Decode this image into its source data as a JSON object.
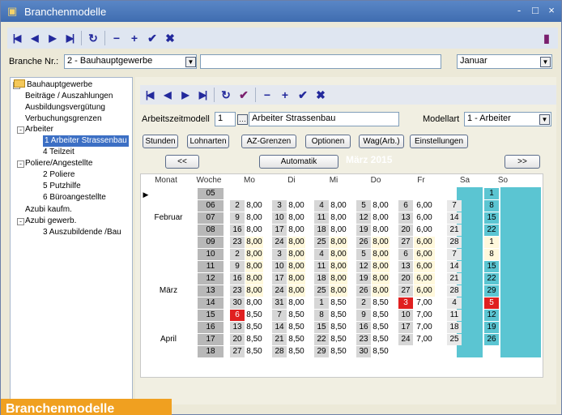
{
  "window": {
    "title": "Branchenmodelle",
    "controls": [
      "-",
      "□",
      "×"
    ]
  },
  "branche": {
    "label": "Branche Nr.:",
    "value": "2 - Bauhauptgewerbe",
    "month": "Januar"
  },
  "tree": [
    {
      "label": "Bauhauptgewerbe",
      "level": 0,
      "expander": "-",
      "folder": true
    },
    {
      "label": "Beiträge / Auszahlungen",
      "level": 1
    },
    {
      "label": "Ausbildungsvergütung",
      "level": 1
    },
    {
      "label": "Verbuchungsgrenzen",
      "level": 1
    },
    {
      "label": "Arbeiter",
      "level": 1,
      "expander": "-"
    },
    {
      "label": "1 Arbeiter Strassenbau",
      "level": 2,
      "selected": true
    },
    {
      "label": "4 Teilzeit",
      "level": 2
    },
    {
      "label": "Poliere/Angestellte",
      "level": 1,
      "expander": "-"
    },
    {
      "label": "2 Poliere",
      "level": 2
    },
    {
      "label": "5 Putzhilfe",
      "level": 2
    },
    {
      "label": "6 Büroangestellte",
      "level": 2
    },
    {
      "label": "Azubi kaufm.",
      "level": 1
    },
    {
      "label": "Azubi gewerb.",
      "level": 1,
      "expander": "-"
    },
    {
      "label": "3 Auszubildende /Bau",
      "level": 2
    }
  ],
  "model": {
    "az_label": "Arbeitszeitmodell",
    "az_nr": "1",
    "az_name": "Arbeiter Strassenbau",
    "art_label": "Modellart",
    "art_value": "1 - Arbeiter"
  },
  "tabs": [
    "Stunden",
    "Lohnarten",
    "AZ-Grenzen",
    "Optionen",
    "Wag(Arb.)",
    "Einstellungen"
  ],
  "nav": {
    "prev": "<<",
    "auto": "Automatik",
    "month": "März 2015",
    "next": ">>"
  },
  "grid": {
    "headers": [
      "Monat",
      "Woche",
      "Mo",
      "Di",
      "Mi",
      "Do",
      "Fr",
      "Sa",
      "So"
    ],
    "months": [
      {
        "row": 2,
        "label": "Februar"
      },
      {
        "row": 8,
        "label": "März"
      },
      {
        "row": 12,
        "label": "April"
      }
    ],
    "rows": [
      {
        "w": "05",
        "d": [
          null,
          null,
          null,
          null,
          null,
          null,
          [
            "1",
            ""
          ]
        ]
      },
      {
        "w": "06",
        "d": [
          [
            "2",
            "8,00"
          ],
          [
            "3",
            "8,00"
          ],
          [
            "4",
            "8,00"
          ],
          [
            "5",
            "8,00"
          ],
          [
            "6",
            "6,00"
          ],
          [
            "7",
            ""
          ],
          [
            "8",
            ""
          ]
        ]
      },
      {
        "w": "07",
        "d": [
          [
            "9",
            "8,00"
          ],
          [
            "10",
            "8,00"
          ],
          [
            "11",
            "8,00"
          ],
          [
            "12",
            "8,00"
          ],
          [
            "13",
            "6,00"
          ],
          [
            "14",
            ""
          ],
          [
            "15",
            ""
          ]
        ]
      },
      {
        "w": "08",
        "d": [
          [
            "16",
            "8,00"
          ],
          [
            "17",
            "8,00"
          ],
          [
            "18",
            "8,00"
          ],
          [
            "19",
            "8,00"
          ],
          [
            "20",
            "6,00"
          ],
          [
            "21",
            ""
          ],
          [
            "22",
            ""
          ]
        ]
      },
      {
        "w": "09",
        "d": [
          [
            "23",
            "8,00"
          ],
          [
            "24",
            "8,00"
          ],
          [
            "25",
            "8,00"
          ],
          [
            "26",
            "8,00"
          ],
          [
            "27",
            "6,00"
          ],
          [
            "28",
            ""
          ],
          [
            "1",
            ""
          ]
        ]
      },
      {
        "w": "10",
        "d": [
          [
            "2",
            "8,00"
          ],
          [
            "3",
            "8,00"
          ],
          [
            "4",
            "8,00"
          ],
          [
            "5",
            "8,00"
          ],
          [
            "6",
            "6,00"
          ],
          [
            "7",
            ""
          ],
          [
            "8",
            ""
          ]
        ]
      },
      {
        "w": "11",
        "d": [
          [
            "9",
            "8,00"
          ],
          [
            "10",
            "8,00"
          ],
          [
            "11",
            "8,00"
          ],
          [
            "12",
            "8,00"
          ],
          [
            "13",
            "6,00"
          ],
          [
            "14",
            ""
          ],
          [
            "15",
            ""
          ]
        ]
      },
      {
        "w": "12",
        "d": [
          [
            "16",
            "8,00"
          ],
          [
            "17",
            "8,00"
          ],
          [
            "18",
            "8,00"
          ],
          [
            "19",
            "8,00"
          ],
          [
            "20",
            "6,00"
          ],
          [
            "21",
            ""
          ],
          [
            "22",
            ""
          ]
        ]
      },
      {
        "w": "13",
        "d": [
          [
            "23",
            "8,00"
          ],
          [
            "24",
            "8,00"
          ],
          [
            "25",
            "8,00"
          ],
          [
            "26",
            "8,00"
          ],
          [
            "27",
            "6,00"
          ],
          [
            "28",
            ""
          ],
          [
            "29",
            ""
          ]
        ]
      },
      {
        "w": "14",
        "d": [
          [
            "30",
            "8,00"
          ],
          [
            "31",
            "8,00"
          ],
          [
            "1",
            "8,50"
          ],
          [
            "2",
            "8,50"
          ],
          [
            "3",
            "7,00"
          ],
          [
            "4",
            ""
          ],
          [
            "5",
            ""
          ]
        ]
      },
      {
        "w": "15",
        "d": [
          [
            "6",
            "8,50"
          ],
          [
            "7",
            "8,50"
          ],
          [
            "8",
            "8,50"
          ],
          [
            "9",
            "8,50"
          ],
          [
            "10",
            "7,00"
          ],
          [
            "11",
            ""
          ],
          [
            "12",
            ""
          ]
        ]
      },
      {
        "w": "16",
        "d": [
          [
            "13",
            "8,50"
          ],
          [
            "14",
            "8,50"
          ],
          [
            "15",
            "8,50"
          ],
          [
            "16",
            "8,50"
          ],
          [
            "17",
            "7,00"
          ],
          [
            "18",
            ""
          ],
          [
            "19",
            ""
          ]
        ]
      },
      {
        "w": "17",
        "d": [
          [
            "20",
            "8,50"
          ],
          [
            "21",
            "8,50"
          ],
          [
            "22",
            "8,50"
          ],
          [
            "23",
            "8,50"
          ],
          [
            "24",
            "7,00"
          ],
          [
            "25",
            ""
          ],
          [
            "26",
            ""
          ]
        ]
      },
      {
        "w": "18",
        "d": [
          [
            "27",
            "8,50"
          ],
          [
            "28",
            "8,50"
          ],
          [
            "29",
            "8,50"
          ],
          [
            "30",
            "8,50"
          ],
          null,
          null,
          null
        ]
      }
    ],
    "holidays": [
      [
        9,
        4
      ],
      [
        9,
        6
      ],
      [
        10,
        0
      ]
    ]
  },
  "banner": "Branchenmodelle",
  "colors": {
    "titlebar": "#3f6db0",
    "highlight": "#3c6fc4",
    "week": "#b8b8b8",
    "day": "#d6d6d6",
    "yellow": "#fff8dc",
    "weekend": "#5bc5d2",
    "holiday": "#e02020",
    "banner": "#f0a020"
  }
}
